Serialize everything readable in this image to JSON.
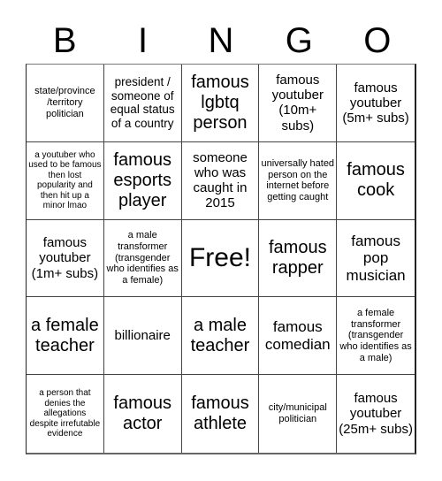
{
  "title_letters": [
    "B",
    "I",
    "N",
    "G",
    "O"
  ],
  "cells": [
    {
      "text": "state/province /territory politician",
      "size": "s"
    },
    {
      "text": "president / someone of equal status of a country",
      "size": "m"
    },
    {
      "text": "famous lgbtq person",
      "size": "xl"
    },
    {
      "text": "famous youtuber (10m+ subs)",
      "size": "ml"
    },
    {
      "text": "famous youtuber (5m+ subs)",
      "size": "ml"
    },
    {
      "text": "a youtuber who used to be famous then lost popularity and then hit up a minor lmao",
      "size": "xs"
    },
    {
      "text": "famous esports player",
      "size": "xl"
    },
    {
      "text": "someone who was caught in 2015",
      "size": "ml"
    },
    {
      "text": "universally hated person on the internet before getting caught",
      "size": "s"
    },
    {
      "text": "famous cook",
      "size": "xl"
    },
    {
      "text": "famous youtuber (1m+ subs)",
      "size": "ml"
    },
    {
      "text": "a male transformer (transgender who identifies as a female)",
      "size": "s"
    },
    {
      "text": "Free!",
      "size": "xxl"
    },
    {
      "text": "famous rapper",
      "size": "xl"
    },
    {
      "text": "famous pop musician",
      "size": "l"
    },
    {
      "text": "a female teacher",
      "size": "xl"
    },
    {
      "text": "billionaire",
      "size": "ml"
    },
    {
      "text": "a male teacher",
      "size": "xl"
    },
    {
      "text": "famous comedian",
      "size": "l"
    },
    {
      "text": "a female transformer (transgender who identifies as a male)",
      "size": "s"
    },
    {
      "text": "a person that denies the allegations despite irrefutable evidence",
      "size": "xs"
    },
    {
      "text": "famous actor",
      "size": "xl"
    },
    {
      "text": "famous athlete",
      "size": "xl"
    },
    {
      "text": "city/municipal politician",
      "size": "s"
    },
    {
      "text": "famous youtuber (25m+ subs)",
      "size": "ml"
    }
  ]
}
